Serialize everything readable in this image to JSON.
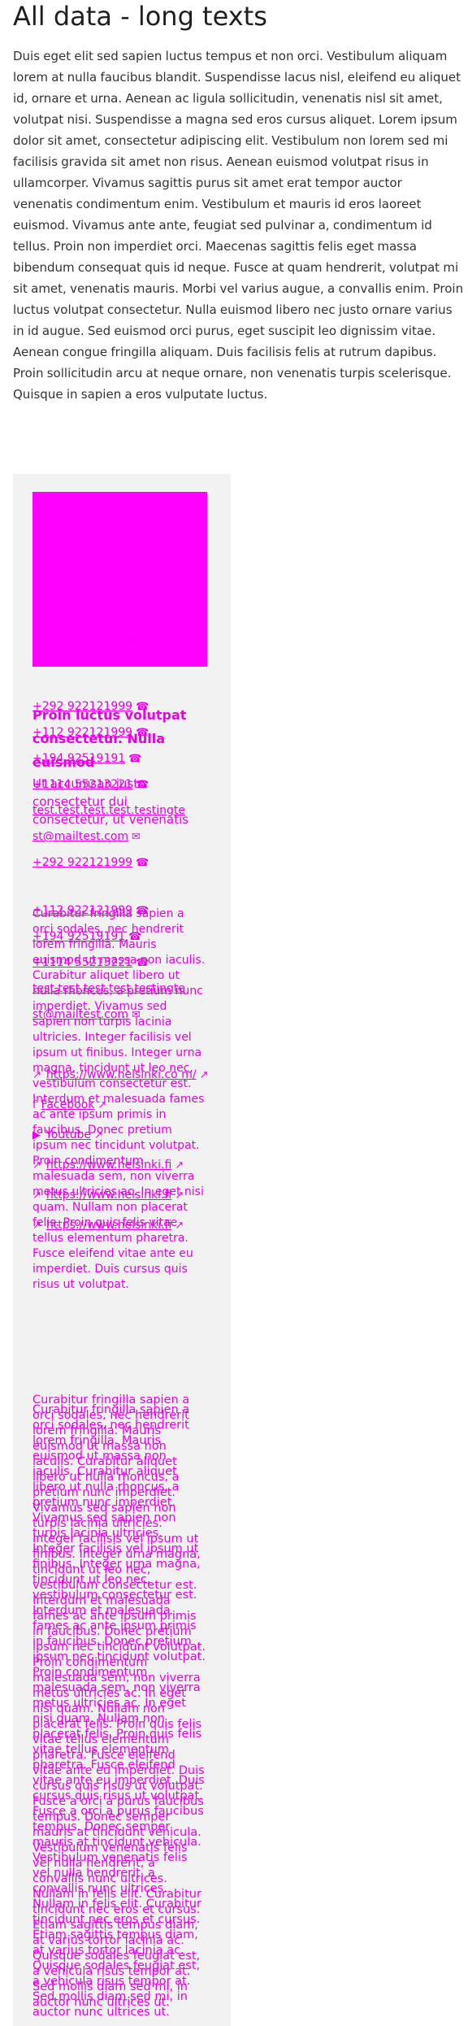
{
  "page": {
    "title": "All data - long texts",
    "intro": "Duis eget elit sed sapien luctus tempus et non orci. Vestibulum aliquam lorem at nulla faucibus blandit. Suspendisse lacus nisl, eleifend eu aliquet id, ornare et urna. Aenean ac ligula sollicitudin, venenatis nisl sit amet, volutpat nisi. Suspendisse a magna sed eros cursus aliquet. Lorem ipsum dolor sit amet, consectetur adipiscing elit. Vestibulum non lorem sed mi facilisis gravida sit amet non risus. Aenean euismod volutpat risus in ullamcorper. Vivamus sagittis purus sit amet erat tempor auctor venenatis condimentum enim. Vestibulum et mauris id eros laoreet euismod. Vivamus ante ante, feugiat sed pulvinar a, condimentum id tellus. Proin non imperdiet orci. Maecenas sagittis felis eget massa bibendum consequat quis id neque. Fusce at quam hendrerit, volutpat mi sit amet, venenatis mauris. Morbi vel varius augue, a convallis enim. Proin luctus volutpat consectetur. Nulla euismod libero nec justo ornare varius in id augue. Sed euismod orci purus, eget suscipit leo dignissim vitae. Aenean congue fringilla aliquam. Duis facilisis felis at rutrum dapibus. Proin sollicitudin arcu at neque ornare, non venenatis turpis scelerisque. Quisque in sapien a eros vulputate luctus."
  },
  "card": {
    "image_alt": "ls",
    "heading": "Proin luctus volutpat consectetur. Nulla euismod",
    "subheading": "Ut accumsan justo consectetur dui consectetur, ut venenatis",
    "contacts_a": [
      {
        "text": "+292 922121999",
        "icon": "phone-icon"
      },
      {
        "text": "+112 922121999",
        "icon": "phone-icon"
      },
      {
        "text": "+194 92519191",
        "icon": "phone-icon"
      },
      {
        "text": "+1114 55213221",
        "icon": "phone-icon"
      },
      {
        "text": "test.test.test.test.testingte",
        "icon": "none"
      },
      {
        "text": "st@mailtest.com",
        "icon": "mail-icon"
      },
      {
        "text": "+292 922121999",
        "icon": "phone-icon"
      }
    ],
    "contacts_b": [
      {
        "text": "+112 922121999",
        "icon": "phone-icon"
      },
      {
        "text": "+194 92519191",
        "icon": "phone-icon"
      },
      {
        "text": "+1114 55213221",
        "icon": "phone-icon"
      },
      {
        "text": "test.test.test.test.testingte",
        "icon": "none"
      },
      {
        "text": "st@mailtest.com",
        "icon": "mail-icon"
      }
    ],
    "body_text": "Curabitur fringilla sapien a orci sodales, nec hendrerit lorem fringilla. Mauris euismod ut massa non iaculis. Curabitur aliquet libero ut nulla rhoncus, a pretium nunc imperdiet. Vivamus sed sapien non turpis lacinia ultricies. Integer facilisis vel ipsum ut finibus. Integer urna magna, tincidunt ut leo nec, vestibulum consectetur est. Interdum et malesuada fames ac ante ipsum primis in faucibus. Donec pretium ipsum nec tincidunt volutpat. Proin condimentum malesuada sem, non viverra metus ultricies ac. In eget nisi quam. Nullam non placerat felis. Proin quis felis vitae tellus elementum pharetra. Fusce eleifend vitae ante eu imperdiet. Duis cursus quis risus ut volutpat.",
    "links": [
      {
        "text": "https://www.helsinki.co m/",
        "icon": "link-icon",
        "ext": "external-link-icon"
      },
      {
        "text": "Facebook",
        "icon": "facebook-icon",
        "ext": "external-link-icon"
      },
      {
        "text": "Youtube",
        "icon": "youtube-icon",
        "ext": "external-link-icon"
      },
      {
        "text": "https://www.helsinki.fi",
        "icon": "link-icon",
        "ext": "external-link-icon"
      },
      {
        "text": "https://www.helsinki.fi",
        "icon": "link-icon",
        "ext": "external-link-icon"
      },
      {
        "text": "https://www.helsinki.fi",
        "icon": "link-icon",
        "ext": "external-link-icon"
      }
    ],
    "body_text_repeat": "Curabitur fringilla sapien a orci sodales, nec hendrerit lorem fringilla. Mauris euismod ut massa non iaculis. Curabitur aliquet libero ut nulla rhoncus, a pretium nunc imperdiet. Vivamus sed sapien non turpis lacinia ultricies. Integer facilisis vel ipsum ut finibus. Integer urna magna, tincidunt ut leo nec, vestibulum consectetur est. Interdum et malesuada fames ac ante ipsum primis in faucibus. Donec pretium ipsum nec tincidunt volutpat. Proin condimentum malesuada sem, non viverra metus ultricies ac. In eget nisi quam. Nullam non placerat felis. Proin quis felis vitae tellus elementum pharetra. Fusce eleifend vitae ante eu imperdiet. Duis cursus quis risus ut volutpat. Fusce a orci a purus faucibus tempus. Donec semper mauris at tincidunt vehicula. Vestibulum venenatis felis vel nulla hendrerit, a convallis nunc ultrices. Nullam in felis elit. Curabitur tincidunt nec eros et cursus. Etiam sagittis tempus diam, at varius tortor lacinia ac. Quisque sodales feugiat est, a vehicula risus tempor at. Sed mollis diam sed mi, in auctor nunc ultrices ut."
  },
  "colors": {
    "accent": "#ff00ff",
    "text_overlay": "#e600e6",
    "card_bg": "#f2f2f2",
    "body_text": "#333333"
  }
}
